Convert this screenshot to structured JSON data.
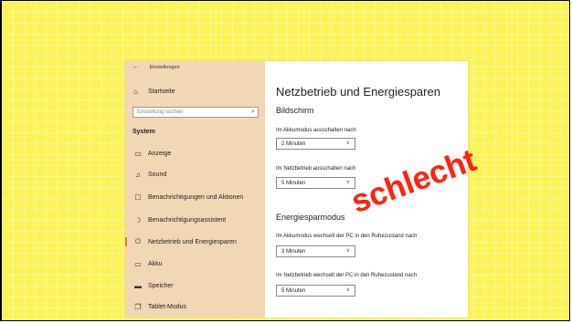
{
  "window": {
    "title": "Einstellungen",
    "back_icon": "←"
  },
  "sidebar": {
    "home": {
      "label": "Startseite",
      "icon": "⌂"
    },
    "search": {
      "placeholder": "Einstellung suchen",
      "icon": "⌕"
    },
    "section_label": "System",
    "items": [
      {
        "label": "Anzeige",
        "icon": "▭",
        "icon_name": "display-icon"
      },
      {
        "label": "Sound",
        "icon": "♫",
        "icon_name": "sound-icon"
      },
      {
        "label": "Benachrichtigungen und Aktionen",
        "icon": "☐",
        "icon_name": "notifications-icon"
      },
      {
        "label": "Benachrichtigungsassistent",
        "icon": "☽",
        "icon_name": "focus-assist-icon"
      },
      {
        "label": "Netzbetrieb und Energiesparen",
        "icon": "⏻",
        "icon_name": "power-icon",
        "active": true
      },
      {
        "label": "Akku",
        "icon": "▭",
        "icon_name": "battery-icon"
      },
      {
        "label": "Speicher",
        "icon": "▬",
        "icon_name": "storage-icon"
      },
      {
        "label": "Tablet-Modus",
        "icon": "❐",
        "icon_name": "tablet-icon"
      }
    ]
  },
  "main": {
    "title": "Netzbetrieb und Energiesparen",
    "screen_section": "Bildschirm",
    "screen_battery_label": "Im Akkumodus ausschalten nach",
    "screen_battery_value": "2 Minuten",
    "screen_power_label": "Im Netzbetrieb ausschalten nach",
    "screen_power_value": "5 Minuten",
    "sleep_section": "Energiesparmodus",
    "sleep_battery_label": "Im Akkumodus wechselt der PC in den Ruhezustand nach",
    "sleep_battery_value": "3 Minuten",
    "sleep_power_label": "Im Netzbetrieb wechselt der PC in den Ruhezustand nach",
    "sleep_power_value": "5 Minuten",
    "chevron": "∨"
  },
  "overlay": {
    "stamp_text": "schlecht",
    "stamp_color": "#ff2310",
    "background_color": "#fbf35a"
  }
}
